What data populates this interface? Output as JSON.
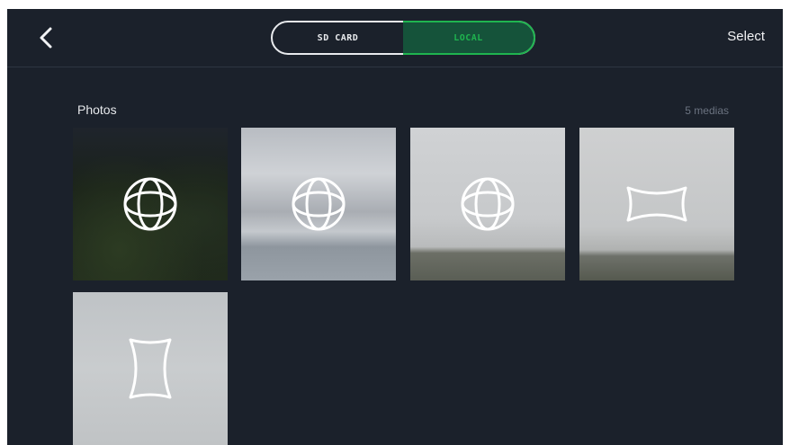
{
  "header": {
    "back_icon": "chevron-left-icon",
    "tabs": [
      {
        "label": "SD CARD",
        "selected": false
      },
      {
        "label": "LOCAL",
        "selected": true
      }
    ],
    "select_label": "Select"
  },
  "section": {
    "title": "Photos",
    "count": "5 medias"
  },
  "media": [
    {
      "type": "spherical-panorama",
      "icon": "sphere-icon"
    },
    {
      "type": "spherical-panorama",
      "icon": "sphere-icon"
    },
    {
      "type": "spherical-panorama",
      "icon": "sphere-icon"
    },
    {
      "type": "horizontal-panorama",
      "icon": "horizontal-panorama-icon"
    },
    {
      "type": "vertical-panorama",
      "icon": "vertical-panorama-icon"
    }
  ],
  "colors": {
    "background": "#1b212b",
    "accent": "#1fb44f",
    "text": "#f2f3f5",
    "muted": "#6b7380"
  }
}
